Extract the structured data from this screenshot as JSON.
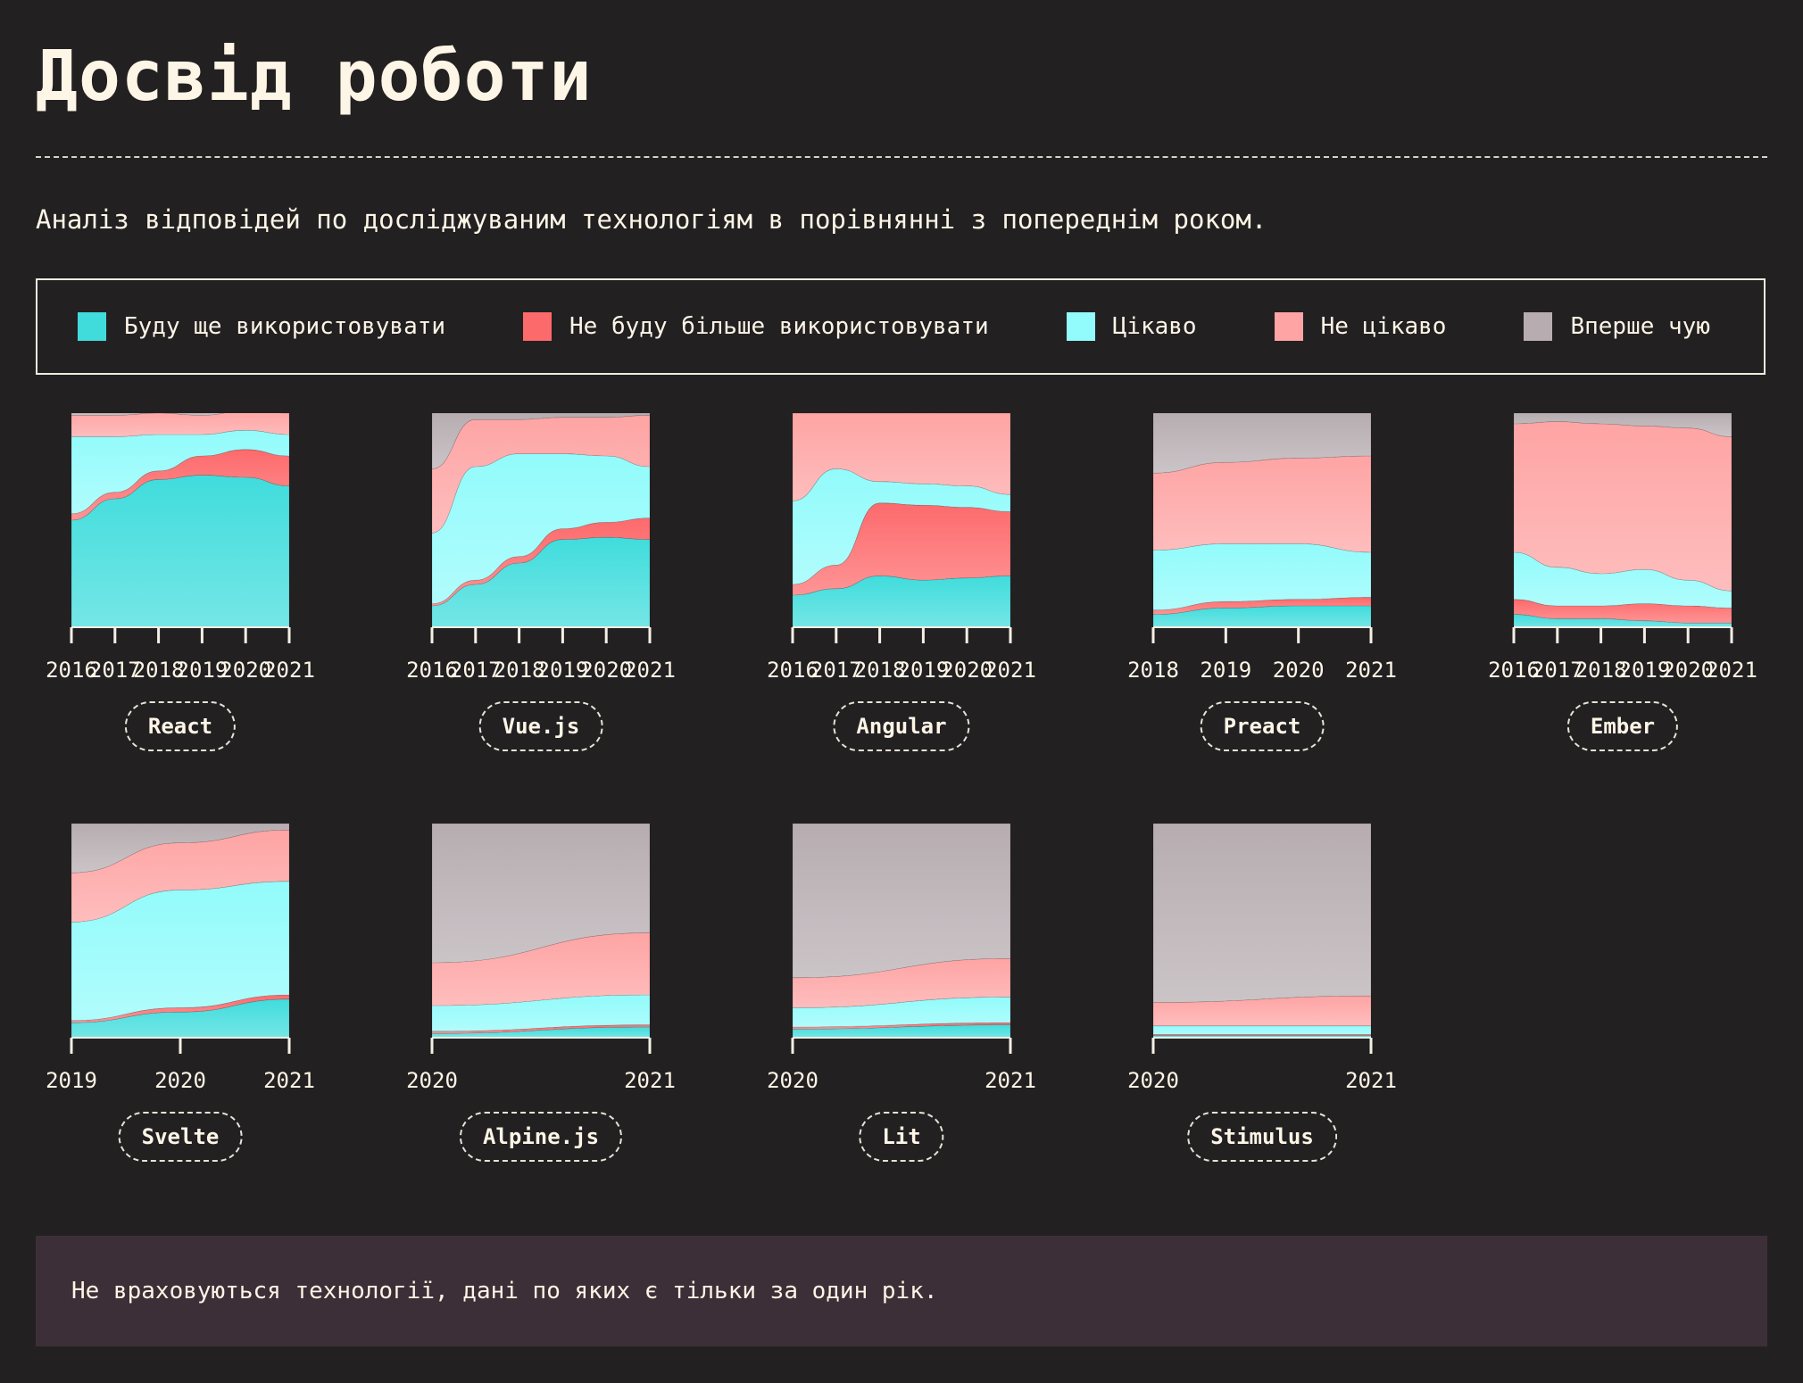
{
  "page": {
    "title": "Досвід роботи",
    "subtitle": "Аналіз відповідей по досліджуваним технологіям в порівнянні з попереднім роком.",
    "note": "Не враховуються технології, дані по яких є тільки за один рік."
  },
  "legend": [
    {
      "key": "would_use",
      "label": "Буду ще використовувати",
      "color": "#40dcdc"
    },
    {
      "key": "would_not_use",
      "label": "Не буду більше використовувати",
      "color": "#fd6a6c"
    },
    {
      "key": "interested",
      "label": "Цікаво",
      "color": "#92fbfb"
    },
    {
      "key": "not_interested",
      "label": "Не цікаво",
      "color": "#fea4a4"
    },
    {
      "key": "never_heard",
      "label": "Вперше чую",
      "color": "#b7adb1"
    }
  ],
  "chart_data": [
    {
      "type": "area",
      "stacked": true,
      "name": "React",
      "x": [
        "2016",
        "2017",
        "2018",
        "2019",
        "2020",
        "2021"
      ],
      "series": [
        {
          "key": "would_use",
          "values": [
            50,
            60,
            69,
            71,
            70,
            66
          ]
        },
        {
          "key": "would_not_use",
          "values": [
            3,
            3,
            4,
            9,
            13,
            14
          ]
        },
        {
          "key": "interested",
          "values": [
            36,
            26,
            17,
            10,
            9,
            10
          ]
        },
        {
          "key": "not_interested",
          "values": [
            10,
            10,
            10,
            9,
            9,
            10
          ]
        },
        {
          "key": "never_heard",
          "values": [
            1,
            1,
            0,
            1,
            0,
            0
          ]
        }
      ]
    },
    {
      "type": "area",
      "stacked": true,
      "name": "Vue.js",
      "x": [
        "2016",
        "2017",
        "2018",
        "2019",
        "2020",
        "2021"
      ],
      "series": [
        {
          "key": "would_use",
          "values": [
            10,
            20,
            30,
            41,
            42,
            41
          ]
        },
        {
          "key": "would_not_use",
          "values": [
            1,
            2,
            3,
            5,
            7,
            10
          ]
        },
        {
          "key": "interested",
          "values": [
            33,
            53,
            48,
            35,
            31,
            24
          ]
        },
        {
          "key": "not_interested",
          "values": [
            30,
            22,
            16,
            17,
            18,
            24
          ]
        },
        {
          "key": "never_heard",
          "values": [
            26,
            3,
            3,
            2,
            2,
            1
          ]
        }
      ]
    },
    {
      "type": "area",
      "stacked": true,
      "name": "Angular",
      "x": [
        "2016",
        "2017",
        "2018",
        "2019",
        "2020",
        "2021"
      ],
      "series": [
        {
          "key": "would_use",
          "values": [
            15,
            18,
            24,
            22,
            23,
            24
          ]
        },
        {
          "key": "would_not_use",
          "values": [
            5,
            11,
            34,
            35,
            33,
            30
          ]
        },
        {
          "key": "interested",
          "values": [
            39,
            45,
            10,
            10,
            10,
            8
          ]
        },
        {
          "key": "not_interested",
          "values": [
            41,
            26,
            32,
            33,
            34,
            38
          ]
        },
        {
          "key": "never_heard",
          "values": [
            0,
            0,
            0,
            0,
            0,
            0
          ]
        }
      ]
    },
    {
      "type": "area",
      "stacked": true,
      "name": "Preact",
      "x": [
        "2018",
        "2019",
        "2020",
        "2021"
      ],
      "series": [
        {
          "key": "would_use",
          "values": [
            6,
            9,
            10,
            10
          ]
        },
        {
          "key": "would_not_use",
          "values": [
            2,
            3,
            3,
            4
          ]
        },
        {
          "key": "interested",
          "values": [
            28,
            27,
            26,
            21
          ]
        },
        {
          "key": "not_interested",
          "values": [
            36,
            38,
            40,
            45
          ]
        },
        {
          "key": "never_heard",
          "values": [
            28,
            23,
            21,
            20
          ]
        }
      ]
    },
    {
      "type": "area",
      "stacked": true,
      "name": "Ember",
      "x": [
        "2016",
        "2017",
        "2018",
        "2019",
        "2020",
        "2021"
      ],
      "series": [
        {
          "key": "would_use",
          "values": [
            6,
            4,
            4,
            3,
            2,
            2
          ]
        },
        {
          "key": "would_not_use",
          "values": [
            7,
            6,
            6,
            8,
            8,
            7
          ]
        },
        {
          "key": "interested",
          "values": [
            22,
            18,
            15,
            16,
            12,
            8
          ]
        },
        {
          "key": "not_interested",
          "values": [
            60,
            68,
            70,
            67,
            71,
            72
          ]
        },
        {
          "key": "never_heard",
          "values": [
            5,
            4,
            5,
            6,
            7,
            11
          ]
        }
      ]
    },
    {
      "type": "area",
      "stacked": true,
      "name": "Svelte",
      "x": [
        "2019",
        "2020",
        "2021"
      ],
      "series": [
        {
          "key": "would_use",
          "values": [
            7,
            12,
            18
          ]
        },
        {
          "key": "would_not_use",
          "values": [
            1,
            2,
            2
          ]
        },
        {
          "key": "interested",
          "values": [
            46,
            55,
            53
          ]
        },
        {
          "key": "not_interested",
          "values": [
            23,
            22,
            24
          ]
        },
        {
          "key": "never_heard",
          "values": [
            23,
            9,
            3
          ]
        }
      ]
    },
    {
      "type": "area",
      "stacked": true,
      "name": "Alpine.js",
      "x": [
        "2020",
        "2021"
      ],
      "series": [
        {
          "key": "would_use",
          "values": [
            2,
            5
          ]
        },
        {
          "key": "would_not_use",
          "values": [
            1,
            1
          ]
        },
        {
          "key": "interested",
          "values": [
            12,
            14
          ]
        },
        {
          "key": "not_interested",
          "values": [
            20,
            29
          ]
        },
        {
          "key": "never_heard",
          "values": [
            65,
            51
          ]
        }
      ]
    },
    {
      "type": "area",
      "stacked": true,
      "name": "Lit",
      "x": [
        "2020",
        "2021"
      ],
      "series": [
        {
          "key": "would_use",
          "values": [
            4,
            6
          ]
        },
        {
          "key": "would_not_use",
          "values": [
            1,
            1
          ]
        },
        {
          "key": "interested",
          "values": [
            9,
            12
          ]
        },
        {
          "key": "not_interested",
          "values": [
            14,
            18
          ]
        },
        {
          "key": "never_heard",
          "values": [
            72,
            63
          ]
        }
      ]
    },
    {
      "type": "area",
      "stacked": true,
      "name": "Stimulus",
      "x": [
        "2020",
        "2021"
      ],
      "series": [
        {
          "key": "would_use",
          "values": [
            1,
            1
          ]
        },
        {
          "key": "would_not_use",
          "values": [
            0.5,
            0.5
          ]
        },
        {
          "key": "interested",
          "values": [
            4,
            4
          ]
        },
        {
          "key": "not_interested",
          "values": [
            11,
            14
          ]
        },
        {
          "key": "never_heard",
          "values": [
            83.5,
            80.5
          ]
        }
      ]
    }
  ]
}
